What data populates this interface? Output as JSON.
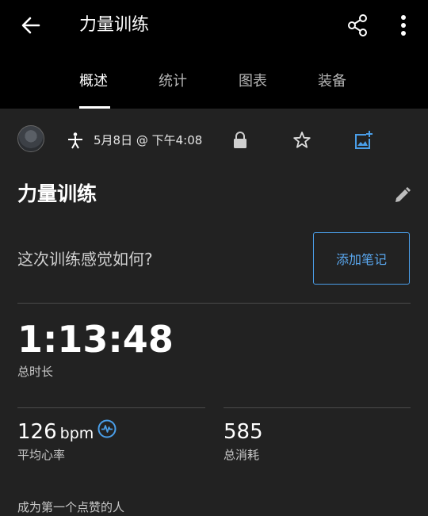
{
  "appbar": {
    "title": "力量训练"
  },
  "tabs": [
    {
      "label": "概述",
      "active": true
    },
    {
      "label": "统计",
      "active": false
    },
    {
      "label": "图表",
      "active": false
    },
    {
      "label": "装备",
      "active": false
    }
  ],
  "activity": {
    "datetime": "5月8日 @ 下午4:08",
    "title": "力量训练",
    "feeling_prompt": "这次训练感觉如何?",
    "add_note_label": "添加笔记"
  },
  "stats": {
    "duration": {
      "value": "1:13:48",
      "label": "总时长"
    },
    "avg_hr": {
      "value": "126",
      "unit": "bpm",
      "label": "平均心率"
    },
    "calories": {
      "value": "585",
      "label": "总消耗"
    }
  },
  "social": {
    "like_prompt": "成为第一个点赞的人"
  },
  "colors": {
    "background": "#222222",
    "topbar": "#000000",
    "accent": "#4a9ee8"
  },
  "icons": [
    "back-arrow-icon",
    "share-icon",
    "more-vertical-icon",
    "strength-activity-icon",
    "lock-icon",
    "star-icon",
    "add-photo-icon",
    "edit-pencil-icon",
    "heart-rate-icon"
  ]
}
